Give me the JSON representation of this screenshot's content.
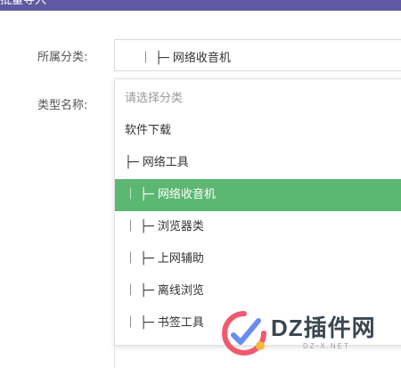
{
  "dialog": {
    "title": "批量导入"
  },
  "form": {
    "category_label": "所属分类:",
    "category_value": "｜ ├─ 网络收音机",
    "type_label": "类型名称:"
  },
  "dropdown": {
    "options": [
      {
        "label": "请选择分类",
        "state": "placeholder"
      },
      {
        "label": "软件下载",
        "state": "normal"
      },
      {
        "label": "├─ 网络工具",
        "state": "normal"
      },
      {
        "label": "｜ ├─ 网络收音机",
        "state": "selected"
      },
      {
        "label": "｜ ├─ 浏览器类",
        "state": "normal"
      },
      {
        "label": "｜ ├─ 上网辅助",
        "state": "normal"
      },
      {
        "label": "｜ ├─ 离线浏览",
        "state": "normal"
      },
      {
        "label": "｜ ├─ 书签工具",
        "state": "normal"
      }
    ],
    "selected_color": "#5cb772"
  },
  "watermark": {
    "text": "DZ插件网",
    "subtext": "DZ-X.NET",
    "icon": "dz-logo-icon"
  },
  "colors": {
    "titlebar": "#5f5aa2",
    "selected_option": "#5cb772"
  }
}
